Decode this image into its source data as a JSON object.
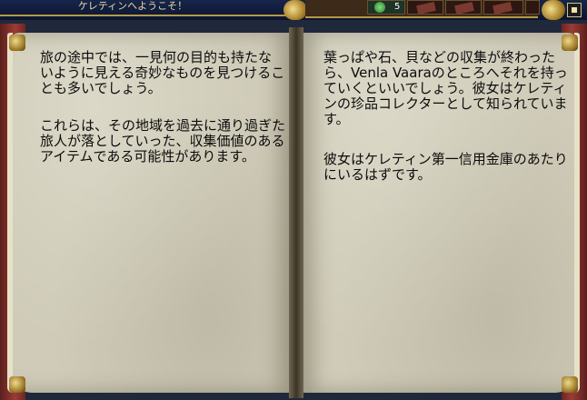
{
  "hud": {
    "title": "ケレティンへようこそ！",
    "slot_count": "5",
    "icons": {
      "slot_1": "herb-icon",
      "slot_book": "book-icon",
      "menu": "menu-icon"
    }
  },
  "book": {
    "left_page": {
      "paragraphs": [
        "旅の途中では、一見何の目的も持たないように見える奇妙なものを見つけることも多いでしょう。",
        "これらは、その地域を過去に通り過ぎた旅人が落としていった、収集価値のあるアイテムである可能性があります。"
      ]
    },
    "right_page": {
      "paragraphs": [
        "葉っぱや石、貝などの収集が終わったら、Venla Vaaraのところへそれを持っていくといいでしょう。彼女はケレティンの珍品コレクターとして知られています。",
        "彼女はケレティン第一信用金庫のあたりにいるはずです。"
      ]
    }
  },
  "colors": {
    "page": "#cfcbb8",
    "cover": "#9a3c36",
    "gold": "#b59a45",
    "hud_text": "#e8d8a0"
  }
}
